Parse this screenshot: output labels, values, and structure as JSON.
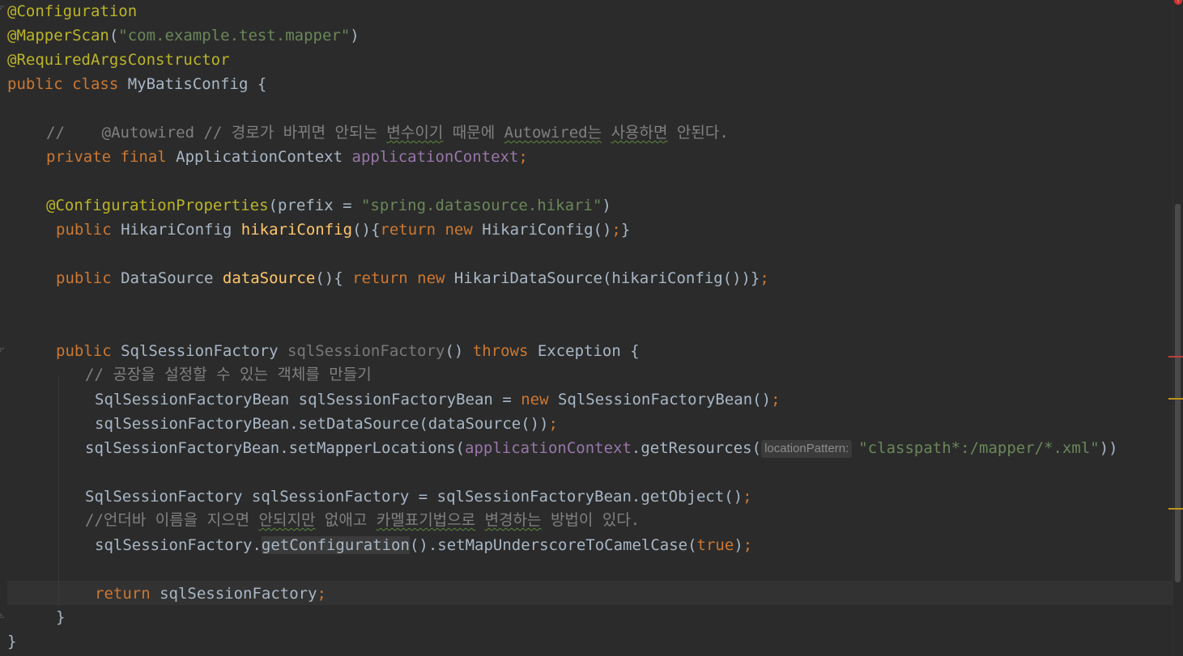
{
  "editor": {
    "lines": [
      {
        "id": "l1",
        "segments": [
          {
            "t": "@Configuration",
            "c": "ann"
          }
        ]
      },
      {
        "id": "l2",
        "segments": [
          {
            "t": "@MapperScan",
            "c": "ann"
          },
          {
            "t": "(",
            "c": ""
          },
          {
            "t": "\"com.example.test.mapper\"",
            "c": "str"
          },
          {
            "t": ")",
            "c": ""
          }
        ]
      },
      {
        "id": "l3",
        "segments": [
          {
            "t": "@RequiredArgsConstructor",
            "c": "ann"
          }
        ]
      },
      {
        "id": "l4",
        "segments": [
          {
            "t": "public class ",
            "c": "kw"
          },
          {
            "t": "MyBatisConfig {",
            "c": ""
          }
        ]
      },
      {
        "id": "l5",
        "segments": [
          {
            "t": "//    @Autowired // 경로가 바뀌면 안되는 ",
            "c": "cm"
          },
          {
            "t": "변수이기",
            "c": "cm squig"
          },
          {
            "t": " 때문에 ",
            "c": "cm"
          },
          {
            "t": "Autowired는",
            "c": "cm squig"
          },
          {
            "t": " ",
            "c": "cm"
          },
          {
            "t": "사용하면",
            "c": "cm squig"
          },
          {
            "t": " 안된다.",
            "c": "cm"
          }
        ]
      },
      {
        "id": "l6",
        "segments": [
          {
            "t": "private final ",
            "c": "kw"
          },
          {
            "t": "ApplicationContext ",
            "c": ""
          },
          {
            "t": "applicationContext",
            "c": "fld"
          },
          {
            "t": ";",
            "c": "kw"
          }
        ]
      },
      {
        "id": "l7",
        "segments": [
          {
            "t": "@ConfigurationProperties",
            "c": "ann"
          },
          {
            "t": "(",
            "c": ""
          },
          {
            "t": "prefix",
            "c": ""
          },
          {
            "t": " = ",
            "c": ""
          },
          {
            "t": "\"spring.datasource.hikari\"",
            "c": "str"
          },
          {
            "t": ")",
            "c": ""
          }
        ]
      },
      {
        "id": "l8",
        "segments": [
          {
            "t": "public ",
            "c": "kw"
          },
          {
            "t": "HikariConfig ",
            "c": ""
          },
          {
            "t": "hikariConfig",
            "c": "fn"
          },
          {
            "t": "(){",
            "c": ""
          },
          {
            "t": "return new ",
            "c": "kw"
          },
          {
            "t": "HikariConfig()",
            "c": ""
          },
          {
            "t": ";",
            "c": "kw"
          },
          {
            "t": "}",
            "c": ""
          }
        ]
      },
      {
        "id": "l9",
        "segments": [
          {
            "t": "public ",
            "c": "kw"
          },
          {
            "t": "DataSource ",
            "c": ""
          },
          {
            "t": "dataSource",
            "c": "fn"
          },
          {
            "t": "(){ ",
            "c": ""
          },
          {
            "t": "return new ",
            "c": "kw"
          },
          {
            "t": "HikariDataSource(hikariConfig())}",
            "c": ""
          },
          {
            "t": ";",
            "c": "kw"
          }
        ]
      },
      {
        "id": "l10",
        "segments": [
          {
            "t": "public ",
            "c": "kw"
          },
          {
            "t": "SqlSessionFactory ",
            "c": ""
          },
          {
            "t": "sqlSessionFactory",
            "c": "dim"
          },
          {
            "t": "() ",
            "c": ""
          },
          {
            "t": "throws ",
            "c": "kw"
          },
          {
            "t": "Exception {",
            "c": ""
          }
        ]
      },
      {
        "id": "l11",
        "segments": [
          {
            "t": "// 공장을 설정할 수 있는 객체를 만들기",
            "c": "cm"
          }
        ]
      },
      {
        "id": "l12",
        "segments": [
          {
            "t": "SqlSessionFactoryBean sqlSessionFactoryBean = ",
            "c": ""
          },
          {
            "t": "new ",
            "c": "kw"
          },
          {
            "t": "SqlSessionFactoryBean()",
            "c": ""
          },
          {
            "t": ";",
            "c": "kw"
          }
        ]
      },
      {
        "id": "l13",
        "segments": [
          {
            "t": "sqlSessionFactoryBean.setDataSource(dataSource())",
            "c": ""
          },
          {
            "t": ";",
            "c": "kw"
          }
        ]
      },
      {
        "id": "l14",
        "segments": [
          {
            "t": "sqlSessionFactoryBean.setMapperLocations(",
            "c": ""
          },
          {
            "t": "applicationContext",
            "c": "fld"
          },
          {
            "t": ".getResources(",
            "c": ""
          },
          {
            "t": "locationPattern:",
            "c": "hint"
          },
          {
            "t": "\"classpath*:/mapper/*.xml\"",
            "c": "str"
          },
          {
            "t": "))",
            "c": ""
          }
        ]
      },
      {
        "id": "l15",
        "segments": [
          {
            "t": "SqlSessionFactory sqlSessionFactory = sqlSessionFactoryBean.getObject()",
            "c": ""
          },
          {
            "t": ";",
            "c": "kw"
          }
        ]
      },
      {
        "id": "l16",
        "segments": [
          {
            "t": "//언더바 이름을 지으면 ",
            "c": "cm"
          },
          {
            "t": "안되지만",
            "c": "cm squig"
          },
          {
            "t": " 없애고 ",
            "c": "cm"
          },
          {
            "t": "카멜표기법으로",
            "c": "cm squig"
          },
          {
            "t": " ",
            "c": "cm"
          },
          {
            "t": "변경하는",
            "c": "cm squig"
          },
          {
            "t": " 방법이 있다.",
            "c": "cm"
          }
        ]
      },
      {
        "id": "l17",
        "segments": [
          {
            "t": "sqlSessionFactory.",
            "c": ""
          },
          {
            "t": "getConfiguration",
            "c": "hl"
          },
          {
            "t": "().setMapUnderscoreToCamelCase(",
            "c": ""
          },
          {
            "t": "true",
            "c": "kw"
          },
          {
            "t": ")",
            "c": ""
          },
          {
            "t": ";",
            "c": "kw"
          }
        ]
      },
      {
        "id": "l18",
        "segments": [
          {
            "t": "return ",
            "c": "kw"
          },
          {
            "t": "sqlSessionFactory",
            "c": ""
          },
          {
            "t": ";",
            "c": "kw"
          }
        ]
      },
      {
        "id": "l19",
        "segments": [
          {
            "t": "}",
            "c": ""
          }
        ]
      },
      {
        "id": "l20",
        "segments": [
          {
            "t": "}",
            "c": ""
          }
        ]
      }
    ]
  },
  "scrollbar": {
    "error_icon": "!",
    "marker_colors": {
      "error": "#bc3f3c",
      "warning": "#be9117"
    }
  },
  "colors": {
    "background": "#2b2b2b",
    "default_text": "#a9b7c6",
    "keyword": "#cc7832",
    "annotation": "#bbb529",
    "string": "#6a8759",
    "method": "#ffc66d",
    "field": "#9876aa",
    "comment": "#808080"
  }
}
